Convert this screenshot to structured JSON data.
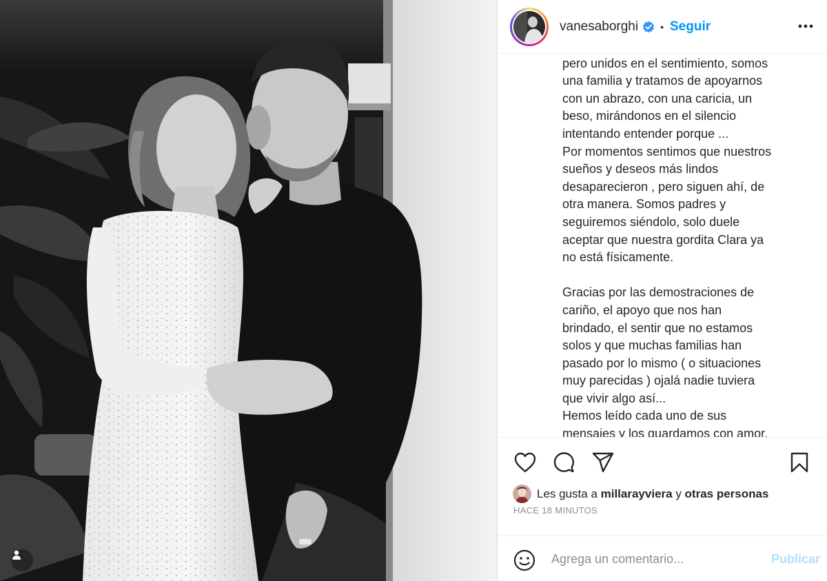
{
  "post": {
    "username": "vanesaborghi",
    "verified_icon": "verified-badge-icon",
    "separator": "•",
    "follow_label": "Seguir",
    "more_icon": "more-options-icon"
  },
  "caption": {
    "text": "y yo solos en casa, con el corazón roto,\npero unidos en el sentimiento, somos\nuna familia y tratamos de apoyarnos\ncon un abrazo, con una caricia, un\nbeso, mirándonos en el silencio\nintentando entender porque ...\nPor momentos sentimos que nuestros\nsueños y deseos más lindos\ndesaparecieron , pero siguen ahí, de\notra manera. Somos padres y\nseguiremos siéndolo, solo duele\naceptar que nuestra gordita Clara ya\nno está físicamente.\n\nGracias por las demostraciones de\ncariño, el apoyo que nos han\nbrindado, el sentir que no estamos\nsolos y que muchas familias han\npasado por lo mismo ( o situaciones\nmuy parecidas ) ojalá nadie tuviera\nque vivir algo así...\nHemos leído cada uno de sus\nmensajes y los guardamos con amor."
  },
  "likes": {
    "prefix": "Les gusta a ",
    "user": "millarayviera",
    "middle": " y ",
    "others": "otras personas"
  },
  "timestamp": "HACE 18 MINUTOS",
  "comment": {
    "placeholder": "Agrega un comentario...",
    "publish_label": "Publicar"
  },
  "colors": {
    "accent": "#0095f6",
    "publish_disabled": "#b2dffc",
    "text": "#262626",
    "muted": "#8e8e8e",
    "border": "#dbdbdb"
  }
}
